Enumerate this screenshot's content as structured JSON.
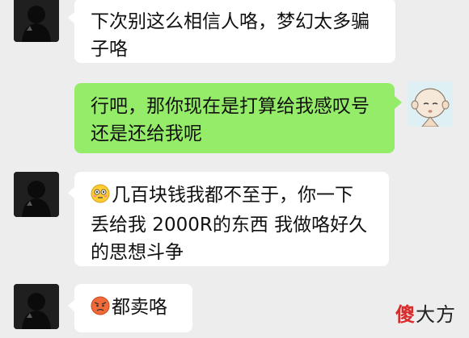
{
  "messages": [
    {
      "side": "left",
      "text_line1": "下次别这么相信人咯，梦幻太多骗",
      "text_line2": "子咯",
      "avatar": "dark-silhouette-avatar"
    },
    {
      "side": "right",
      "text_line1": "行吧，那你现在是打算给我感叹号",
      "text_line2": "还是还给我呢",
      "avatar": "bald-cartoon-avatar"
    },
    {
      "side": "left",
      "emoji": "flushed-face",
      "text_line1": "几百块钱我都不至于，你一下",
      "text_line2": "丢给我 2000R的东西 我做咯好久",
      "text_line3": "的思想斗争",
      "avatar": "dark-silhouette-avatar"
    },
    {
      "side": "left",
      "emoji": "angry-face",
      "text_line1": "都卖咯",
      "avatar": "dark-silhouette-avatar"
    }
  ],
  "watermark": {
    "part1": "傻",
    "part2": "大方"
  },
  "colors": {
    "background": "#ededed",
    "left_bubble": "#ffffff",
    "right_bubble": "#95ec69"
  }
}
